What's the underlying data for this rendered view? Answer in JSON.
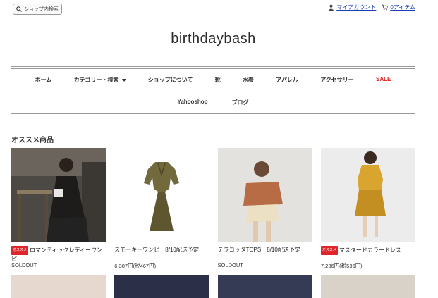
{
  "header": {
    "search_label": "ショップ内検索",
    "account_label": "マイアカウント",
    "cart_label": "0アイテム",
    "logo": "birthdaybash"
  },
  "nav": {
    "row1": [
      "ホーム",
      "カテゴリー・検索",
      "ショップについて",
      "靴",
      "水着",
      "アパレル",
      "アクセサリー",
      "SALE"
    ],
    "row2": [
      "Yahooshop",
      "ブログ"
    ]
  },
  "section": {
    "title": "オススメ商品"
  },
  "products": [
    {
      "badge": "オススメ",
      "name": "ロマンティックレディーワンピ",
      "price": "",
      "status": "SOLDOUT",
      "photo_colors": [
        "#4c4844",
        "#1d1c1b",
        "#e8e6e0"
      ]
    },
    {
      "badge": "",
      "name": "スモーキーワンピ　8/10配送予定",
      "price": "6,307円(税467円)",
      "status": "",
      "photo_colors": [
        "#ffffff",
        "#726a3c",
        "#5d562f"
      ]
    },
    {
      "badge": "",
      "name": "テラコッタTOPS　8/10配送予定",
      "price": "",
      "status": "SOLDOUT",
      "photo_colors": [
        "#e4e2de",
        "#b86c45",
        "#ece0c4"
      ]
    },
    {
      "badge": "オススメ",
      "name": "マスタードカラードレス",
      "price": "7,236円(税536円)",
      "status": "",
      "photo_colors": [
        "#ececec",
        "#d9a52e",
        "#c48f22"
      ]
    }
  ],
  "row2_photo_colors": [
    "#e7d8cf",
    "#2c2f48",
    "#353a55",
    "#d8d2c8"
  ]
}
